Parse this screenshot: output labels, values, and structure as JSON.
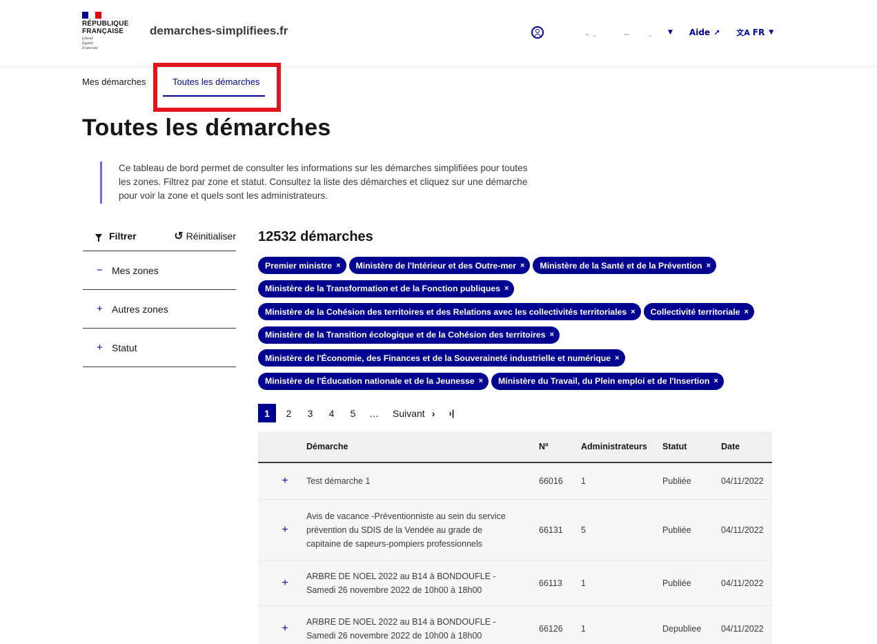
{
  "header": {
    "rf_name": [
      "République",
      "Française"
    ],
    "rf_motto": [
      "Liberté",
      "Égalité",
      "Fraternité"
    ],
    "site_name": "demarches-simplifiees.fr",
    "help_label": "Aide",
    "lang_label": "FR"
  },
  "tabs": [
    {
      "label": "Mes démarches"
    },
    {
      "label": "Toutes les démarches"
    }
  ],
  "page": {
    "title": "Toutes les démarches",
    "intro": "Ce tableau de bord permet de consulter les informations sur les démarches simplifiées pour toutes les zones. Filtrez par zone et statut. Consultez la liste des démarches et cliquez sur une démarche pour voir la zone et quels sont les administrateurs."
  },
  "sidebar": {
    "filter_label": "Filtrer",
    "reset_label": "Réinitialiser",
    "sections": [
      {
        "sign": "−",
        "label": "Mes zones"
      },
      {
        "sign": "+",
        "label": "Autres zones"
      },
      {
        "sign": "+",
        "label": "Statut"
      }
    ]
  },
  "results": {
    "count": "12532 démarches",
    "tags": [
      [
        "Premier ministre",
        "Ministère de l'Intérieur et des Outre-mer",
        "Ministère de la Santé et de la Prévention"
      ],
      [
        "Ministère de la Transformation et de la Fonction publiques"
      ],
      [
        "Ministère de la Cohésion des territoires et des Relations avec les collectivités territoriales",
        "Collectivité territoriale"
      ],
      [
        "Ministère de la Transition écologique et de la Cohésion des territoires"
      ],
      [
        "Ministère de l'Économie, des Finances et de la Souveraineté industrielle et numérique"
      ],
      [
        "Ministère de l'Éducation nationale et de la Jeunesse",
        "Ministère du Travail, du Plein emploi et de l'Insertion"
      ]
    ],
    "tag_remove": "×"
  },
  "pagination": {
    "pages": [
      "1",
      "2",
      "3",
      "4",
      "5"
    ],
    "ellipsis": "…",
    "next_label": "Suivant",
    "next_icon": "›",
    "last_icon": "›|"
  },
  "table": {
    "columns": [
      "Démarche",
      "Nº",
      "Administrateurs",
      "Statut",
      "Date"
    ],
    "expand_sign": "+",
    "rows": [
      {
        "demarche": "Test démarche 1",
        "num": "66016",
        "admins": "1",
        "statut": "Publiée",
        "date": "04/11/2022"
      },
      {
        "demarche": "Avis de vacance -Préventionniste au sein du service prévention du SDIS de la Vendée au grade de capitaine de sapeurs-pompiers professionnels",
        "num": "66131",
        "admins": "5",
        "statut": "Publiée",
        "date": "04/11/2022"
      },
      {
        "demarche": "ARBRE DE NOEL 2022 au B14 à BONDOUFLE - Samedi 26 novembre 2022 de 10h00 à 18h00",
        "num": "66113",
        "admins": "1",
        "statut": "Publiée",
        "date": "04/11/2022"
      },
      {
        "demarche": "ARBRE DE NOEL 2022 au B14 à BONDOUFLE - Samedi 26 novembre 2022 de 10h00 à 18h00",
        "num": "66126",
        "admins": "1",
        "statut": "Depubliee",
        "date": "04/11/2022"
      }
    ]
  },
  "colors": {
    "accent": "#000091",
    "highlight": "#e2151f",
    "callout_border": "#6a6af4"
  }
}
